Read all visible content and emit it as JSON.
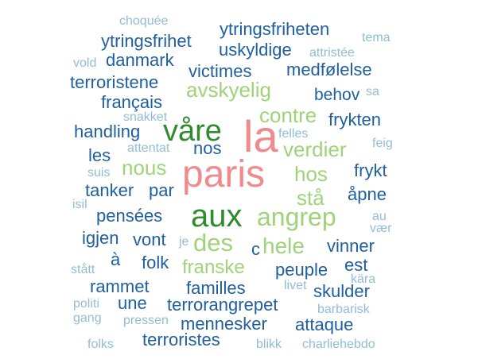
{
  "palette": {
    "dark_blue": "#1f5fa0",
    "light_blue": "#92bcd6",
    "light_green": "#9ed37a",
    "dark_green": "#2e8b2e",
    "pink": "#f08a8c"
  },
  "words": [
    {
      "text": "paris",
      "color": "#f08a8c"
    },
    {
      "text": "la",
      "color": "#f08a8c"
    },
    {
      "text": "våre",
      "color": "#2e8b2e"
    },
    {
      "text": "aux",
      "color": "#2e8b2e"
    },
    {
      "text": "angrep",
      "color": "#9ed37a"
    },
    {
      "text": "des",
      "color": "#9ed37a"
    },
    {
      "text": "hele",
      "color": "#9ed37a"
    },
    {
      "text": "c",
      "color": "#1f5fa0"
    },
    {
      "text": "franske",
      "color": "#9ed37a"
    },
    {
      "text": "avskyelig",
      "color": "#9ed37a"
    },
    {
      "text": "contre",
      "color": "#9ed37a"
    },
    {
      "text": "verdier",
      "color": "#9ed37a"
    },
    {
      "text": "nous",
      "color": "#9ed37a"
    },
    {
      "text": "hos",
      "color": "#9ed37a"
    },
    {
      "text": "stå",
      "color": "#9ed37a"
    },
    {
      "text": "ytringsfriheten",
      "color": "#1f5fa0"
    },
    {
      "text": "ytringsfrihet",
      "color": "#1f5fa0"
    },
    {
      "text": "uskyldige",
      "color": "#1f5fa0"
    },
    {
      "text": "danmark",
      "color": "#1f5fa0"
    },
    {
      "text": "victimes",
      "color": "#1f5fa0"
    },
    {
      "text": "medfølelse",
      "color": "#1f5fa0"
    },
    {
      "text": "terroristene",
      "color": "#1f5fa0"
    },
    {
      "text": "behov",
      "color": "#1f5fa0"
    },
    {
      "text": "français",
      "color": "#1f5fa0"
    },
    {
      "text": "frykten",
      "color": "#1f5fa0"
    },
    {
      "text": "handling",
      "color": "#1f5fa0"
    },
    {
      "text": "nos",
      "color": "#1f5fa0"
    },
    {
      "text": "les",
      "color": "#1f5fa0"
    },
    {
      "text": "frykt",
      "color": "#1f5fa0"
    },
    {
      "text": "tanker",
      "color": "#1f5fa0"
    },
    {
      "text": "par",
      "color": "#1f5fa0"
    },
    {
      "text": "åpne",
      "color": "#1f5fa0"
    },
    {
      "text": "pensées",
      "color": "#1f5fa0"
    },
    {
      "text": "igjen",
      "color": "#1f5fa0"
    },
    {
      "text": "vont",
      "color": "#1f5fa0"
    },
    {
      "text": "vinner",
      "color": "#1f5fa0"
    },
    {
      "text": "à",
      "color": "#1f5fa0"
    },
    {
      "text": "folk",
      "color": "#1f5fa0"
    },
    {
      "text": "peuple",
      "color": "#1f5fa0"
    },
    {
      "text": "est",
      "color": "#1f5fa0"
    },
    {
      "text": "rammet",
      "color": "#1f5fa0"
    },
    {
      "text": "familles",
      "color": "#1f5fa0"
    },
    {
      "text": "skulder",
      "color": "#1f5fa0"
    },
    {
      "text": "une",
      "color": "#1f5fa0"
    },
    {
      "text": "terrorangrepet",
      "color": "#1f5fa0"
    },
    {
      "text": "mennesker",
      "color": "#1f5fa0"
    },
    {
      "text": "attaque",
      "color": "#1f5fa0"
    },
    {
      "text": "terroristes",
      "color": "#1f5fa0"
    },
    {
      "text": "choquée",
      "color": "#92bcd6"
    },
    {
      "text": "tema",
      "color": "#92bcd6"
    },
    {
      "text": "vold",
      "color": "#92bcd6"
    },
    {
      "text": "attristée",
      "color": "#92bcd6"
    },
    {
      "text": "sa",
      "color": "#92bcd6"
    },
    {
      "text": "snakket",
      "color": "#92bcd6"
    },
    {
      "text": "felles",
      "color": "#92bcd6"
    },
    {
      "text": "feig",
      "color": "#92bcd6"
    },
    {
      "text": "attentat",
      "color": "#92bcd6"
    },
    {
      "text": "suis",
      "color": "#92bcd6"
    },
    {
      "text": "isil",
      "color": "#92bcd6"
    },
    {
      "text": "au",
      "color": "#92bcd6"
    },
    {
      "text": "vær",
      "color": "#92bcd6"
    },
    {
      "text": "je",
      "color": "#92bcd6"
    },
    {
      "text": "stått",
      "color": "#92bcd6"
    },
    {
      "text": "kära",
      "color": "#92bcd6"
    },
    {
      "text": "livet",
      "color": "#92bcd6"
    },
    {
      "text": "politi",
      "color": "#92bcd6"
    },
    {
      "text": "barbarisk",
      "color": "#92bcd6"
    },
    {
      "text": "gang",
      "color": "#92bcd6"
    },
    {
      "text": "pressen",
      "color": "#92bcd6"
    },
    {
      "text": "folks",
      "color": "#92bcd6"
    },
    {
      "text": "blikk",
      "color": "#92bcd6"
    },
    {
      "text": "charliehebdo",
      "color": "#92bcd6"
    }
  ]
}
